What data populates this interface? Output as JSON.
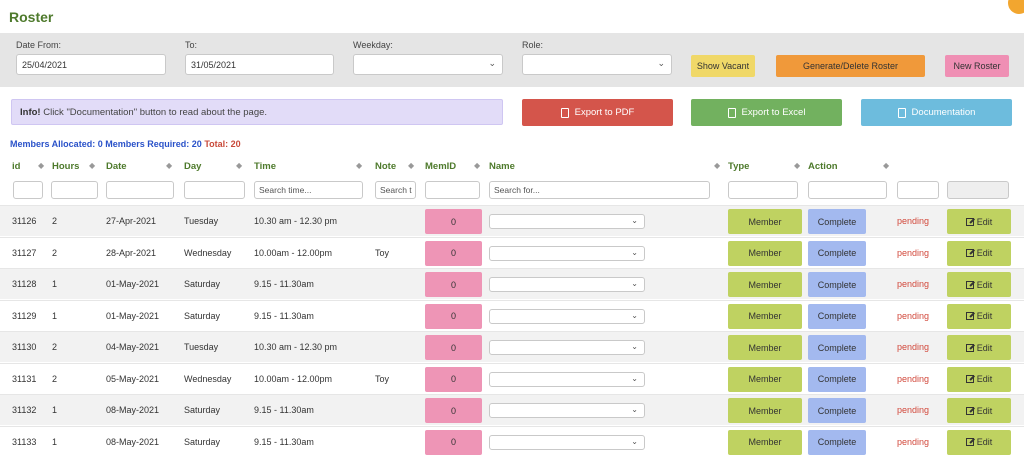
{
  "page": {
    "title": "Roster"
  },
  "filters": {
    "date_from_label": "Date From:",
    "date_from_value": "25/04/2021",
    "to_label": "To:",
    "to_value": "31/05/2021",
    "weekday_label": "Weekday:",
    "weekday_value": "",
    "role_label": "Role:",
    "role_value": "",
    "show_vacant": "Show Vacant",
    "generate_delete": "Generate/Delete Roster",
    "new_roster": "New Roster"
  },
  "info": {
    "prefix": "Info!",
    "text": "Click \"Documentation\" button to read about the page."
  },
  "actions": {
    "export_pdf": "Export to PDF",
    "export_excel": "Export to Excel",
    "documentation": "Documentation"
  },
  "summary": {
    "allocated_label": "Members Allocated:",
    "allocated": "0",
    "required_label": "Members Required:",
    "required": "20",
    "total_label": "Total:",
    "total": "20"
  },
  "table": {
    "headers": {
      "id": "id",
      "hours": "Hours",
      "date": "Date",
      "day": "Day",
      "time": "Time",
      "note": "Note",
      "memid": "MemID",
      "name": "Name",
      "type": "Type",
      "action": "Action"
    },
    "search": {
      "time_placeholder": "Search time...",
      "note_placeholder": "Search t",
      "name_placeholder": "Search for..."
    },
    "rows": [
      {
        "id": "31126",
        "hours": "2",
        "date": "27-Apr-2021",
        "day": "Tuesday",
        "time": "10.30 am - 12.30 pm",
        "note": "",
        "memid": "0",
        "type": "Member",
        "action": "Complete",
        "status": "pending",
        "edit": "Edit"
      },
      {
        "id": "31127",
        "hours": "2",
        "date": "28-Apr-2021",
        "day": "Wednesday",
        "time": "10.00am - 12.00pm",
        "note": "Toy",
        "memid": "0",
        "type": "Member",
        "action": "Complete",
        "status": "pending",
        "edit": "Edit"
      },
      {
        "id": "31128",
        "hours": "1",
        "date": "01-May-2021",
        "day": "Saturday",
        "time": "9.15 - 11.30am",
        "note": "",
        "memid": "0",
        "type": "Member",
        "action": "Complete",
        "status": "pending",
        "edit": "Edit"
      },
      {
        "id": "31129",
        "hours": "1",
        "date": "01-May-2021",
        "day": "Saturday",
        "time": "9.15 - 11.30am",
        "note": "",
        "memid": "0",
        "type": "Member",
        "action": "Complete",
        "status": "pending",
        "edit": "Edit"
      },
      {
        "id": "31130",
        "hours": "2",
        "date": "04-May-2021",
        "day": "Tuesday",
        "time": "10.30 am - 12.30 pm",
        "note": "",
        "memid": "0",
        "type": "Member",
        "action": "Complete",
        "status": "pending",
        "edit": "Edit"
      },
      {
        "id": "31131",
        "hours": "2",
        "date": "05-May-2021",
        "day": "Wednesday",
        "time": "10.00am - 12.00pm",
        "note": "Toy",
        "memid": "0",
        "type": "Member",
        "action": "Complete",
        "status": "pending",
        "edit": "Edit"
      },
      {
        "id": "31132",
        "hours": "1",
        "date": "08-May-2021",
        "day": "Saturday",
        "time": "9.15 - 11.30am",
        "note": "",
        "memid": "0",
        "type": "Member",
        "action": "Complete",
        "status": "pending",
        "edit": "Edit"
      },
      {
        "id": "31133",
        "hours": "1",
        "date": "08-May-2021",
        "day": "Saturday",
        "time": "9.15 - 11.30am",
        "note": "",
        "memid": "0",
        "type": "Member",
        "action": "Complete",
        "status": "pending",
        "edit": "Edit"
      }
    ]
  },
  "colors": {
    "title": "#4e7a2c",
    "pdf": "#d4554b",
    "excel": "#72b15f",
    "docs": "#6dbcdd",
    "show_vacant": "#f0d868",
    "generate": "#f0993a",
    "new_roster": "#ef8fb4",
    "memid": "#ee95b6",
    "type": "#bfd261",
    "action": "#a3b9ef",
    "status": "#d2493c"
  },
  "icons": {
    "pdf": "pdf-file-icon",
    "excel": "excel-file-icon",
    "docs": "document-icon",
    "edit": "edit-icon",
    "sort": "sort-arrows-icon",
    "dropdown": "chevron-down-icon"
  }
}
